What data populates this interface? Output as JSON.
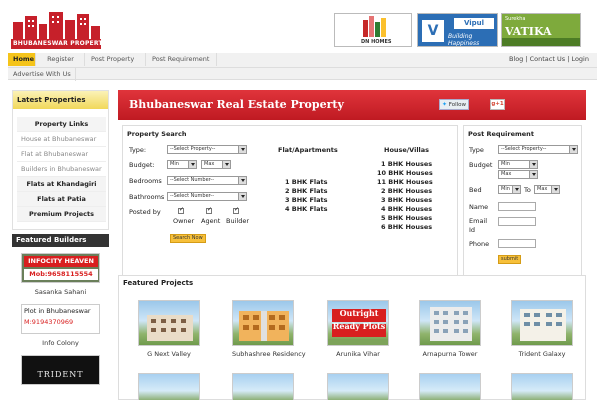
{
  "brand": {
    "logo_text": "BHUBANESWAR PROPERTY .IN"
  },
  "ads": {
    "dnhomes": "DN HOMES",
    "vipul": {
      "mark": "V",
      "name": "Vipul",
      "tagline": "Building Happiness"
    },
    "vatika": {
      "line1": "Surekha",
      "line2": "VATIKA"
    }
  },
  "nav": {
    "items": [
      "Home",
      "Register",
      "Post Property",
      "Post Requirement"
    ],
    "row2": "Advertise With Us",
    "right": "Blog | Contact Us | Login"
  },
  "sidebar": {
    "latest_title": "Latest Properties",
    "links": [
      {
        "label": "Property Links",
        "bold": true
      },
      {
        "label": "House at Bhubaneswar",
        "bold": false
      },
      {
        "label": "Flat at Bhubaneswar",
        "bold": false
      },
      {
        "label": "Builders in Bhubaneswar",
        "bold": false
      },
      {
        "label": "Flats at Khandagiri",
        "bold": true
      },
      {
        "label": "Flats at Patia",
        "bold": true
      },
      {
        "label": "Premium Projects",
        "bold": true
      }
    ],
    "featured_builders_title": "Featured Builders",
    "builders": [
      {
        "line1": "INFOCITY HEAVEN",
        "line2": "Mob:9658115554",
        "caption": "Sasanka Sahani"
      },
      {
        "line1": "Plot in Bhubaneswar",
        "line2": "M:9194370969",
        "caption": "Info Colony"
      },
      {
        "line1": "TRIDENT",
        "caption": ""
      }
    ]
  },
  "main": {
    "title": "Bhubaneswar Real Estate Property",
    "follow": "Follow",
    "gplus": "g+1"
  },
  "property_search": {
    "heading": "Property Search",
    "type_label": "Type:",
    "type_value": "--Select Property--",
    "budget_label": "Budget:",
    "budget_min": "Min",
    "budget_max": "Max",
    "bedrooms_label": "Bedrooms",
    "bedrooms_value": "--Select Number--",
    "bathrooms_label": "Bathrooms",
    "bathrooms_value": "--Select Number--",
    "posted_by_label": "Posted by",
    "posted_by": [
      "Owner",
      "Agent",
      "Builder"
    ],
    "button": "Search Now",
    "flat_heading": "Flat/Apartments",
    "flats": [
      "1 BHK Flats",
      "2 BHK Flats",
      "3 BHK Flats",
      "4 BHK Flats"
    ],
    "house_heading": "House/Villas",
    "houses": [
      "1 BHK Houses",
      "10 BHK Houses",
      "11 BHK Houses",
      "2 BHK Houses",
      "3 BHK Houses",
      "4 BHK Houses",
      "5 BHK Houses",
      "6 BHK Houses"
    ]
  },
  "post_requirement": {
    "heading": "Post Requirement",
    "type_label": "Type",
    "type_value": "--Select Property--",
    "budget_label": "Budget",
    "budget_min": "Min",
    "budget_max": "Max",
    "bed_label": "Bed",
    "bed_min": "Min",
    "to_label": "To",
    "bed_max": "Max",
    "name_label": "Name",
    "email_label": "Email Id",
    "phone_label": "Phone",
    "button": "submit"
  },
  "featured_projects": {
    "heading": "Featured Projects",
    "items": [
      "G Next Valley",
      "Subhashree Residency",
      "Arunika Vihar",
      "Arnapurna Tower",
      "Trident Galaxy"
    ],
    "outright_text": "Outright Ready Plots"
  }
}
